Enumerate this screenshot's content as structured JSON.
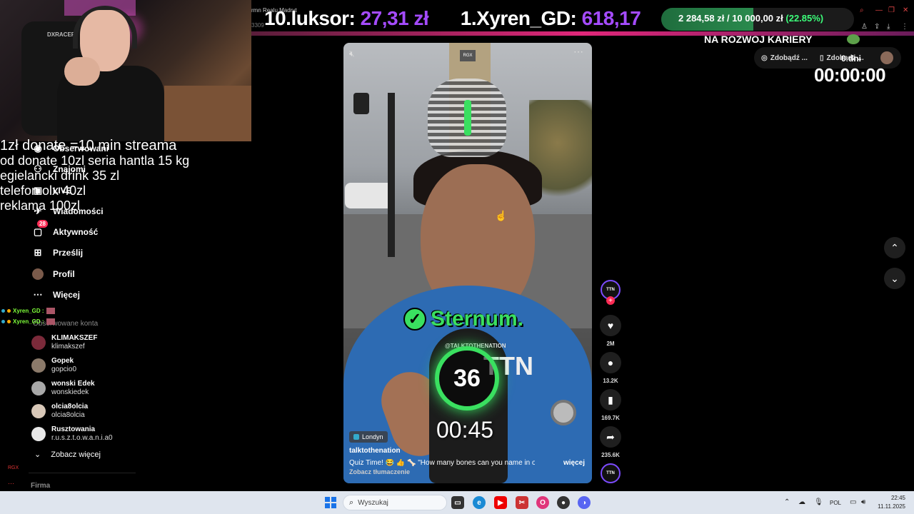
{
  "stream": {
    "tiny_title": "rmn Realu Madryt",
    "tiny_number": "3309",
    "ticker": [
      {
        "rank": "10.",
        "name": "luksor:",
        "amount": "27,31 zł"
      },
      {
        "rank": "1.",
        "name": "Xyren_GD:",
        "amount": "618,17"
      }
    ],
    "goal": {
      "current": "2 284,58 zł",
      "separator": "/",
      "target": "10 000,00 zł",
      "percent_text": "(22.85%)",
      "fraction": 0.2285,
      "caption": "NA ROZWOJ KARIERY"
    },
    "countdown": {
      "days_label": "0 dni",
      "time": "00:00:00"
    },
    "overlay_lines": [
      "1zł donate =10 min streama",
      "od donate 10zl seria hantla 15 kg",
      "egielancki drink 35 zl",
      "telefon olx 40zl",
      "reklama 100zl"
    ],
    "chat": [
      {
        "user": "Xyren_GD :"
      },
      {
        "user": "Xyren_GD :"
      }
    ]
  },
  "header": {
    "pills": [
      "Zdobądź ...",
      "Zdobądź ..."
    ]
  },
  "sidebar": {
    "items": [
      {
        "label": "Obserwowani",
        "icon": "following-icon"
      },
      {
        "label": "Znajomi",
        "icon": "friends-icon"
      },
      {
        "label": "LIVE",
        "icon": "live-icon"
      },
      {
        "label": "Wiadomości",
        "icon": "messages-icon"
      },
      {
        "label": "Aktywność",
        "icon": "activity-icon",
        "badge": "28"
      },
      {
        "label": "Prześlij",
        "icon": "upload-icon"
      },
      {
        "label": "Profil",
        "icon": "profile-avatar"
      },
      {
        "label": "Więcej",
        "icon": "more-icon"
      }
    ],
    "following_label": "Obserwowane konta",
    "accounts": [
      {
        "name": "KLIMAKSZEF",
        "handle": "klimakszef"
      },
      {
        "name": "Gopek",
        "handle": "gopcio0"
      },
      {
        "name": "wonski Edek",
        "handle": "wonskiedek"
      },
      {
        "name": "olcia8olcia",
        "handle": "olcia8olcia"
      },
      {
        "name": "Rusztowania",
        "handle": "r.u.s.z.t.o.w.a.n.i.a0"
      }
    ],
    "see_more": "Zobacz więcej",
    "footer": "Firma"
  },
  "video": {
    "overlay_badge": "RGX",
    "quiz_label": "Sternum.",
    "quiz_count": "36",
    "timer": "00:45",
    "mic_text": "@TALKTOTHENATION",
    "mic_logo": "TTN",
    "location": "Londyn",
    "author": "talktothenation",
    "description": "Quiz Time! 😂 👍 🦴 \"How many bones can you name in one...",
    "more_label": "więcej",
    "translate_label": "Zobacz tłumaczenie"
  },
  "actions": {
    "avatar_text": "TTN",
    "likes": "2M",
    "comments": "13.2K",
    "saves": "169.7K",
    "shares": "235.6K",
    "disc_text": "TTN"
  },
  "taskbar": {
    "search_placeholder": "Wyszukaj",
    "lang": "POL",
    "time": "22:45",
    "date": "11.11.2025"
  }
}
